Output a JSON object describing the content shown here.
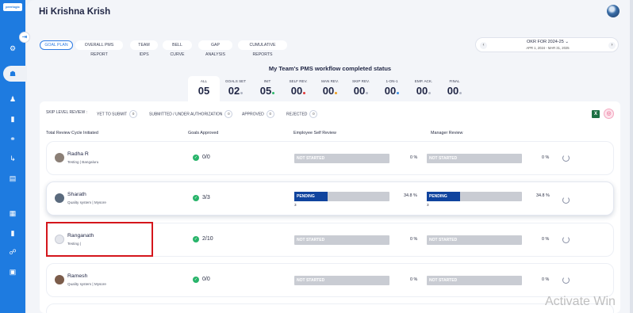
{
  "sidebar": {
    "logo_text": "peerlogic",
    "items": [
      "gear-icon",
      "team-icon",
      "person-icon",
      "book-icon",
      "handshake-icon",
      "flow-icon",
      "document-icon",
      "chart-icon",
      "info-icon",
      "group-icon",
      "report-icon"
    ]
  },
  "header": {
    "greeting": "Hi Krishna Krish"
  },
  "tabs": [
    {
      "label": "GOAL PLAN",
      "active": true
    },
    {
      "label": "OVERALL PMS REPORT"
    },
    {
      "label": "TEAM IDPS"
    },
    {
      "label": "BELL CURVE"
    },
    {
      "label": "GAP ANALYSIS"
    },
    {
      "label": "CUMULATIVE REPORTS"
    }
  ],
  "okr": {
    "title": "OKR FOR 2024-25",
    "range": "APR 1, 2024 - MAR 31, 2025",
    "prev": "‹",
    "next": "›"
  },
  "status": {
    "title": "My Team's PMS workflow completed status",
    "stats": [
      {
        "label": "ALL",
        "value": "05",
        "dot": ""
      },
      {
        "label": "GOALS SET",
        "value": "02",
        "dot": "#b0b5c3"
      },
      {
        "label": "INIT",
        "value": "05",
        "dot": "#2eb86b"
      },
      {
        "label": "SELF REV.",
        "value": "00",
        "dot": "#e23a3a"
      },
      {
        "label": "MAN REV.",
        "value": "00",
        "dot": "#f0a020"
      },
      {
        "label": "SKIP REV.",
        "value": "00",
        "dot": "#b0b5c3"
      },
      {
        "label": "1-ON-1",
        "value": "00",
        "dot": "#3c8de0"
      },
      {
        "label": "EMP. ACK.",
        "value": "00",
        "dot": "#b0b5c3"
      },
      {
        "label": "FINAL",
        "value": "00",
        "dot": "#b0b5c3"
      }
    ]
  },
  "skip": {
    "label": "SKIP LEVEL REVIEW :",
    "items": [
      {
        "label": "YET TO SUBMIT",
        "count": "0"
      },
      {
        "label": "SUBMITTED / UNDER AUTHORIZATION",
        "count": "0"
      },
      {
        "label": "APPROVED",
        "count": "0"
      },
      {
        "label": "REJECTED",
        "count": "0"
      }
    ]
  },
  "columns": {
    "name": "Total Review Cycle Initiated",
    "goals": "Goals Approved",
    "self": "Employee Self Review",
    "manager": "Manager Review"
  },
  "rows": [
    {
      "name": "Radha R",
      "sub": "Testing | Bangaluru",
      "goals": "0/0",
      "self": {
        "status": "NOT STARTED",
        "fill": 0,
        "pct": "0 %",
        "sub": ""
      },
      "manager": {
        "status": "NOT STARTED",
        "fill": 0,
        "pct": "0 %",
        "sub": ""
      }
    },
    {
      "name": "Sharath",
      "sub": "Quality system | Mysore",
      "goals": "3/3",
      "self": {
        "status": "PENDING",
        "fill": 0.348,
        "pct": "34.8 %",
        "sub": "3"
      },
      "manager": {
        "status": "PENDING",
        "fill": 0.348,
        "pct": "34.8 %",
        "sub": "3"
      }
    },
    {
      "name": "Ranganath",
      "sub": "Testing |",
      "goals": "2/10",
      "self": {
        "status": "NOT STARTED",
        "fill": 0,
        "pct": "0 %",
        "sub": ""
      },
      "manager": {
        "status": "NOT STARTED",
        "fill": 0,
        "pct": "0 %",
        "sub": ""
      }
    },
    {
      "name": "Ramesh",
      "sub": "Quality system | Mysore",
      "goals": "0/0",
      "self": {
        "status": "NOT STARTED",
        "fill": 0,
        "pct": "0 %",
        "sub": ""
      },
      "manager": {
        "status": "NOT STARTED",
        "fill": 0,
        "pct": "0 %",
        "sub": ""
      }
    }
  ],
  "watermark": "Activate Win"
}
